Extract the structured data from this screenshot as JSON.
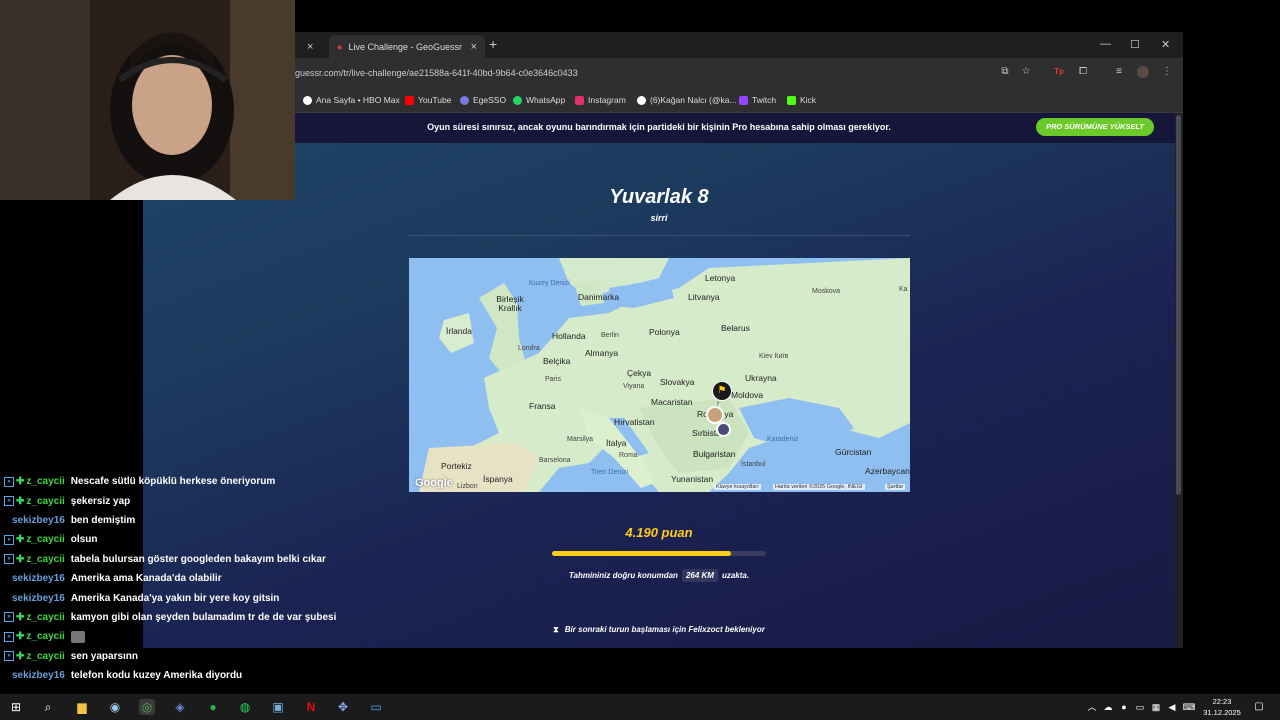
{
  "browser": {
    "prev_tab_close": "×",
    "active_tab_title": "Live Challenge - GeoGuessr",
    "new_tab": "+",
    "url": "guessr.com/tr/live-challenge/ae21588a-641f-40bd-9b64-c0e3646c0433",
    "bookmarks": [
      "Ana Sayfa • HBO Max",
      "YouTube",
      "EgeSSO",
      "WhatsApp",
      "Instagram",
      "(6)Kağan Nalcı (@ka...",
      "Twitch",
      "Kick"
    ],
    "bookmark_colors": [
      "#ffffff",
      "#ff0000",
      "#7a7ae0",
      "#25d366",
      "#e1306c",
      "#ffffff",
      "#9146ff",
      "#53fc18"
    ],
    "extension_badge": "Tp"
  },
  "page": {
    "banner_text": "Oyun süresi sınırsız, ancak oyunu barındırmak için partideki bir kişinin Pro hesabına sahip olması gerekiyor.",
    "pro_button": "PRO SÜRÜMÜNE YÜKSELT",
    "round_title": "Yuvarlak 8",
    "round_subtitle": "sirri",
    "score": "4.190 puan",
    "score_fraction": 0.838,
    "distance_prefix": "Tahmininiz doğru konumdan",
    "distance_value": "264 KM",
    "distance_suffix": "uzakta.",
    "waiting_text": "Bir sonraki turun başlaması için Felixzoct bekleniyor",
    "accent_color": "#fecd19"
  },
  "map": {
    "countries": [
      "Letonya",
      "Birleşik Krallık",
      "Danimarka",
      "Litvanya",
      "İrlanda",
      "Hollanda",
      "Polonya",
      "Belarus",
      "Belçika",
      "Almanya",
      "Ukrayna",
      "Çekya",
      "Slovakya",
      "Fransa",
      "Macaristan",
      "Moldova",
      "Hırvatistan",
      "Sırbistan",
      "İtalya",
      "Bulgaristan",
      "Gürcistan",
      "Portekiz",
      "İspanya",
      "Yunanistan",
      "Azerbaycan",
      "Romanya"
    ],
    "seas": [
      "Kuzey Denizi",
      "Karadeniz",
      "Tiren Denizi"
    ],
    "cities": [
      "Moskova",
      "Berlin",
      "Londra",
      "Kiev Київ",
      "Paris",
      "Viyana",
      "Marsilya",
      "Roma",
      "Barselona",
      "İstanbul",
      "Lizbon",
      "Ka"
    ],
    "logo": "Google",
    "attribution": [
      "Klavye kısayolları",
      "Harita verileri ©2025 Google, INEGI",
      "Şartlar"
    ]
  },
  "chat": [
    {
      "user": "z_caycii",
      "msg": "Nescafe sütlü köpüklü herkese öneriyorum",
      "badge": true
    },
    {
      "user": "z_caycii",
      "msg": "şekersiz yap",
      "badge": true
    },
    {
      "user": "sekizbey16",
      "msg": "ben demiştim",
      "badge": false
    },
    {
      "user": "z_caycii",
      "msg": "olsun",
      "badge": true
    },
    {
      "user": "z_caycii",
      "msg": "tabela bulursan göster googleden bakayım belki cıkar",
      "badge": true
    },
    {
      "user": "sekizbey16",
      "msg": "Amerika ama Kanada'da olabilir",
      "badge": false
    },
    {
      "user": "sekizbey16",
      "msg": "Amerika Kanada'ya yakın bir yere koy gitsin",
      "badge": false
    },
    {
      "user": "z_caycii",
      "msg": "kamyon gibi olan şeyden bulamadım tr de de var şubesi",
      "badge": true
    },
    {
      "user": "z_caycii",
      "msg": "",
      "badge": true
    },
    {
      "user": "z_caycii",
      "msg": "sen yaparsınn",
      "badge": true
    },
    {
      "user": "sekizbey16",
      "msg": "telefon kodu kuzey Amerika diyordu",
      "badge": false
    }
  ],
  "taskbar": {
    "time": "22:23",
    "date": "31.12.2025"
  }
}
